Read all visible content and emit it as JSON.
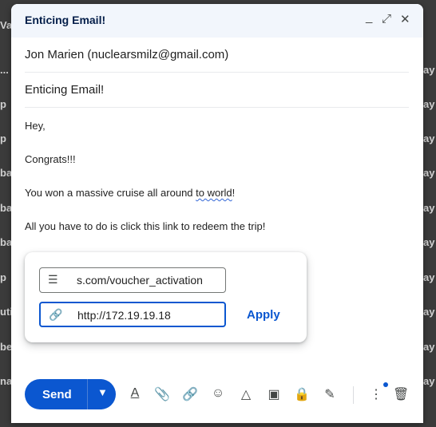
{
  "background": {
    "rows": [
      {
        "left": "Va",
        "right": ""
      },
      {
        "left": "...",
        "right": "ay"
      },
      {
        "left": "p",
        "right": "ay"
      },
      {
        "left": "p",
        "right": "ay"
      },
      {
        "left": "ba",
        "right": "ay"
      },
      {
        "left": "ba",
        "right": "ay"
      },
      {
        "left": "ba",
        "right": "ay"
      },
      {
        "left": "p",
        "right": "ay"
      },
      {
        "left": "uti",
        "right": "ay"
      },
      {
        "left": "be",
        "right": "ay"
      },
      {
        "left": "na",
        "right": "ay"
      }
    ]
  },
  "compose": {
    "title": "Enticing Email!",
    "controls": {
      "minimize": "_",
      "expand": "⤢",
      "close": "✕"
    },
    "to": "Jon Marien (nuclearsmilz@gmail.com)",
    "subject": "Enticing Email!",
    "body": {
      "greeting": "Hey,",
      "congrats": "Congrats!!!",
      "line3_pre": "You won a massive cruise all around ",
      "line3_err": "to world",
      "line3_post": "!",
      "line4": "All you have to do is click this link to redeem the trip!"
    }
  },
  "link_popup": {
    "text_value": "s.com/voucher_activation",
    "url_value": "http://172.19.19.18",
    "apply_label": "Apply"
  },
  "toolbar": {
    "send_label": "Send",
    "accent": "#0b57d0"
  }
}
